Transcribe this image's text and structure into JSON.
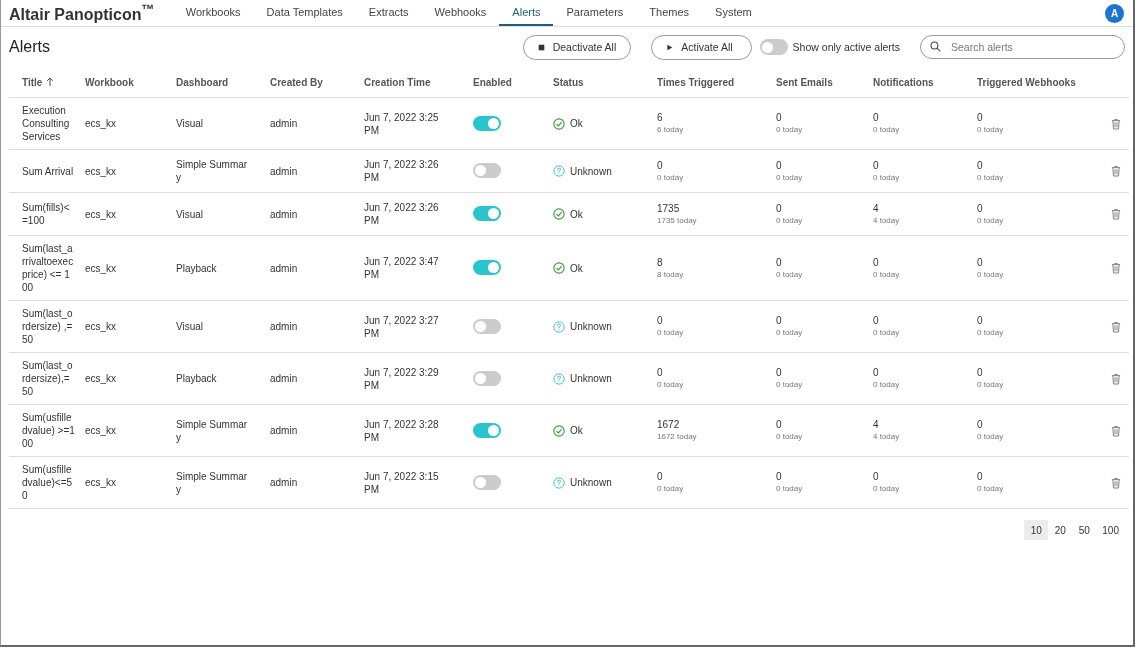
{
  "app": {
    "logo": "Altair Panopticon$^{™}$",
    "avatar": "A"
  },
  "nav": [
    {
      "label": "Workbooks",
      "selected": false
    },
    {
      "label": "Data Templates",
      "selected": false
    },
    {
      "label": "Extracts",
      "selected": false
    },
    {
      "label": "Webhooks",
      "selected": false
    },
    {
      "label": "Alerts",
      "selected": true
    },
    {
      "label": "Parameters",
      "selected": false
    },
    {
      "label": "Themes",
      "selected": false
    },
    {
      "label": "System",
      "selected": false
    }
  ],
  "page_title": "Alerts",
  "toolbar": {
    "deactivate": "Deactivate All",
    "activate": "Activate All",
    "active_only": {
      "label": "Show only active alerts",
      "on": false
    },
    "search": {
      "placeholder": "Search alerts"
    }
  },
  "table": {
    "columns": [
      {
        "label": "Title",
        "sorted": true
      },
      {
        "label": "Workbook",
        "sorted": false
      },
      {
        "label": "Dashboard",
        "sorted": false
      },
      {
        "label": "Created By",
        "sorted": false
      },
      {
        "label": "Creation Time",
        "sorted": false
      },
      {
        "label": "Enabled",
        "sorted": false
      },
      {
        "label": "Status",
        "sorted": false
      },
      {
        "label": "Times Triggered",
        "sorted": false
      },
      {
        "label": "Sent Emails",
        "sorted": false
      },
      {
        "label": "Notifications",
        "sorted": false
      },
      {
        "label": "Triggered Webhooks",
        "sorted": false
      }
    ],
    "rows": [
      {
        "title": "Execution Consulting Services",
        "workbook": "ecs_kx",
        "dashboard": "Visual",
        "created_by": "admin",
        "creation_time": "Jun 7, 2022 3:25 PM",
        "enabled": true,
        "status": {
          "kind": "ok",
          "label": "Ok"
        },
        "counts": [
          {
            "value": "6",
            "today": "6 today"
          },
          {
            "value": "0",
            "today": "0 today"
          },
          {
            "value": "0",
            "today": "0 today"
          },
          {
            "value": "0",
            "today": "0 today"
          }
        ]
      },
      {
        "title": "Sum Arrival",
        "workbook": "ecs_kx",
        "dashboard": "Simple Summary",
        "created_by": "admin",
        "creation_time": "Jun 7, 2022 3:26 PM",
        "enabled": false,
        "status": {
          "kind": "unknown",
          "label": "Unknown"
        },
        "counts": [
          {
            "value": "0",
            "today": "0 today"
          },
          {
            "value": "0",
            "today": "0 today"
          },
          {
            "value": "0",
            "today": "0 today"
          },
          {
            "value": "0",
            "today": "0 today"
          }
        ]
      },
      {
        "title": "Sum(fills)<=100",
        "workbook": "ecs_kx",
        "dashboard": "Visual",
        "created_by": "admin",
        "creation_time": "Jun 7, 2022 3:26 PM",
        "enabled": true,
        "status": {
          "kind": "ok",
          "label": "Ok"
        },
        "counts": [
          {
            "value": "1735",
            "today": "1735 today"
          },
          {
            "value": "0",
            "today": "0 today"
          },
          {
            "value": "4",
            "today": "4 today"
          },
          {
            "value": "0",
            "today": "0 today"
          }
        ]
      },
      {
        "title": "Sum(last_arrivaltoexecprice) <= 100",
        "workbook": "ecs_kx",
        "dashboard": "Playback",
        "created_by": "admin",
        "creation_time": "Jun 7, 2022 3:47 PM",
        "enabled": true,
        "status": {
          "kind": "ok",
          "label": "Ok"
        },
        "counts": [
          {
            "value": "8",
            "today": "8 today"
          },
          {
            "value": "0",
            "today": "0 today"
          },
          {
            "value": "0",
            "today": "0 today"
          },
          {
            "value": "0",
            "today": "0 today"
          }
        ]
      },
      {
        "title": "Sum(last_ordersize) ,= 50",
        "workbook": "ecs_kx",
        "dashboard": "Visual",
        "created_by": "admin",
        "creation_time": "Jun 7, 2022 3:27 PM",
        "enabled": false,
        "status": {
          "kind": "unknown",
          "label": "Unknown"
        },
        "counts": [
          {
            "value": "0",
            "today": "0 today"
          },
          {
            "value": "0",
            "today": "0 today"
          },
          {
            "value": "0",
            "today": "0 today"
          },
          {
            "value": "0",
            "today": "0 today"
          }
        ]
      },
      {
        "title": "Sum(last_ordersize),=50",
        "workbook": "ecs_kx",
        "dashboard": "Playback",
        "created_by": "admin",
        "creation_time": "Jun 7, 2022 3:29 PM",
        "enabled": false,
        "status": {
          "kind": "unknown",
          "label": "Unknown"
        },
        "counts": [
          {
            "value": "0",
            "today": "0 today"
          },
          {
            "value": "0",
            "today": "0 today"
          },
          {
            "value": "0",
            "today": "0 today"
          },
          {
            "value": "0",
            "today": "0 today"
          }
        ]
      },
      {
        "title": "Sum(usfilledvalue) >=100",
        "workbook": "ecs_kx",
        "dashboard": "Simple Summary",
        "created_by": "admin",
        "creation_time": "Jun 7, 2022 3:28 PM",
        "enabled": true,
        "status": {
          "kind": "ok",
          "label": "Ok"
        },
        "counts": [
          {
            "value": "1672",
            "today": "1672 today"
          },
          {
            "value": "0",
            "today": "0 today"
          },
          {
            "value": "4",
            "today": "4 today"
          },
          {
            "value": "0",
            "today": "0 today"
          }
        ]
      },
      {
        "title": "Sum(usfilledvalue)<=50",
        "workbook": "ecs_kx",
        "dashboard": "Simple Summary",
        "created_by": "admin",
        "creation_time": "Jun 7, 2022 3:15 PM",
        "enabled": false,
        "status": {
          "kind": "unknown",
          "label": "Unknown"
        },
        "counts": [
          {
            "value": "0",
            "today": "0 today"
          },
          {
            "value": "0",
            "today": "0 today"
          },
          {
            "value": "0",
            "today": "0 today"
          },
          {
            "value": "0",
            "today": "0 today"
          }
        ]
      }
    ]
  },
  "pagination": [
    {
      "label": "10",
      "selected": true
    },
    {
      "label": "20",
      "selected": false
    },
    {
      "label": "50",
      "selected": false
    },
    {
      "label": "100",
      "selected": false
    }
  ]
}
